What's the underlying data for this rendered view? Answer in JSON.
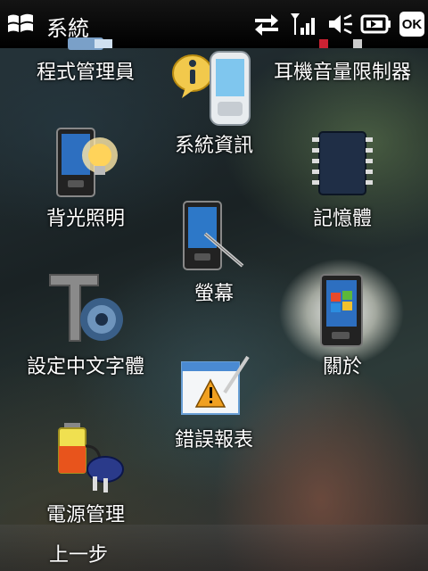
{
  "statusbar": {
    "title": "系統",
    "ok_label": "OK"
  },
  "items": [
    {
      "label": "程式管理員",
      "icon": "program-manager-icon"
    },
    {
      "label": "系統資訊",
      "icon": "system-info-icon"
    },
    {
      "label": "耳機音量限制器",
      "icon": "headset-volume-limiter-icon"
    },
    {
      "label": "背光照明",
      "icon": "backlight-icon"
    },
    {
      "label": "螢幕",
      "icon": "screen-icon"
    },
    {
      "label": "記憶體",
      "icon": "memory-icon"
    },
    {
      "label": "設定中文字體",
      "icon": "chinese-font-settings-icon"
    },
    {
      "label": "關於",
      "icon": "about-icon"
    },
    {
      "label": "錯誤報表",
      "icon": "error-report-icon"
    },
    {
      "label": "電源管理",
      "icon": "power-management-icon"
    }
  ],
  "softkeys": {
    "left": "上一步"
  }
}
